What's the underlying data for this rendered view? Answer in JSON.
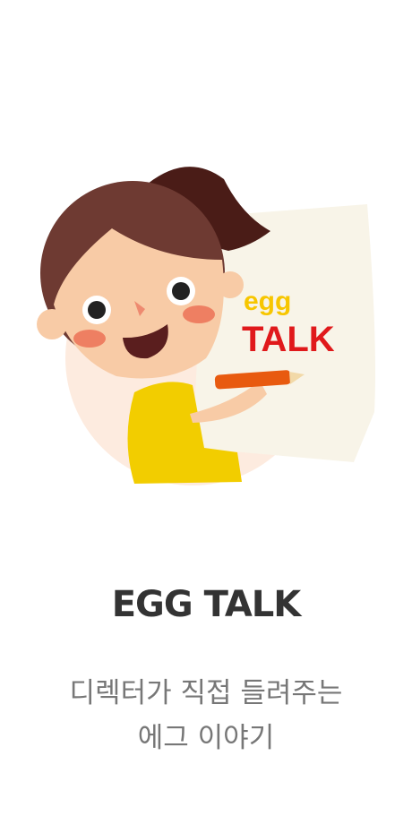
{
  "illustration": {
    "logo_text_top": "egg",
    "logo_text_bottom": "TALK",
    "colors": {
      "circle": "#fdebdf",
      "paper": "#f8f4e8",
      "hair": "#6e3a32",
      "ponytail": "#4a1c17",
      "skin": "#f8cba6",
      "shirt": "#f2cd00",
      "logo_yellow": "#f7c600",
      "logo_red": "#e0191b"
    }
  },
  "title": "EGG TALK",
  "subtitle": [
    "디렉터가 직접 들려주는",
    "에그 이야기"
  ]
}
